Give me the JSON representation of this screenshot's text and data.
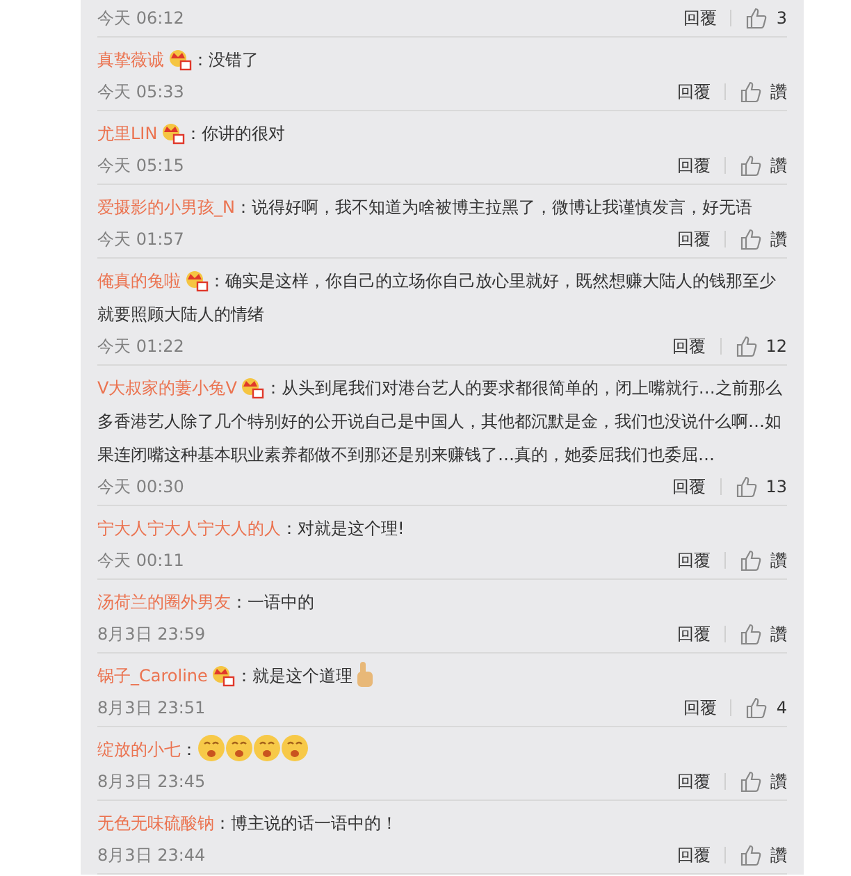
{
  "comments": [
    {
      "partial": true,
      "time": "今天 06:12",
      "reply": "回覆",
      "likes": "3"
    },
    {
      "name": "真挚薇诚",
      "badge": true,
      "text": "：没错了",
      "time": "今天 05:33",
      "reply": "回覆",
      "likes": "讚"
    },
    {
      "name": "尤里LIN",
      "badge": true,
      "text": "：你讲的很对",
      "time": "今天 05:15",
      "reply": "回覆",
      "likes": "讚"
    },
    {
      "name": "爱摄影的小男孩_N",
      "badge": false,
      "text": "：说得好啊，我不知道为啥被博主拉黑了，微博让我谨慎发言，好无语",
      "time": "今天 01:57",
      "reply": "回覆",
      "likes": "讚"
    },
    {
      "name": "俺真的兔啦",
      "badge": true,
      "text": "：确实是这样，你自己的立场你自己放心里就好，既然想赚大陆人的钱那至少就要照顾大陆人的情绪",
      "time": "今天 01:22",
      "reply": "回覆",
      "likes": "12"
    },
    {
      "name": "V大叔家的萋小兔V",
      "badge": true,
      "text": "：从头到尾我们对港台艺人的要求都很简单的，闭上嘴就行…之前那么多香港艺人除了几个特别好的公开说自己是中国人，其他都沉默是金，我们也没说什么啊…如果连闭嘴这种基本职业素养都做不到那还是别来赚钱了…真的，她委屈我们也委屈…",
      "time": "今天 00:30",
      "reply": "回覆",
      "likes": "13"
    },
    {
      "name": "宁大人宁大人宁大人的人",
      "badge": false,
      "text": "：对就是这个理!",
      "time": "今天 00:11",
      "reply": "回覆",
      "likes": "讚"
    },
    {
      "name": "汤荷兰的圈外男友",
      "badge": false,
      "text": "：一语中的",
      "time": "8月3日 23:59",
      "reply": "回覆",
      "likes": "讚"
    },
    {
      "name": "锅子_Caroline",
      "badge": true,
      "text": "：就是这个道理",
      "emojis": [
        {
          "kind": "thumbs-up"
        }
      ],
      "time": "8月3日 23:51",
      "reply": "回覆",
      "likes": "4"
    },
    {
      "name": "绽放的小七",
      "badge": false,
      "text": "：",
      "emojis": [
        {
          "kind": "face"
        },
        {
          "kind": "face"
        },
        {
          "kind": "face"
        },
        {
          "kind": "face"
        }
      ],
      "time": "8月3日 23:45",
      "reply": "回覆",
      "likes": "讚"
    },
    {
      "name": "无色无味硫酸钠",
      "badge": false,
      "text": "：博主说的话一语中的！",
      "time": "8月3日 23:44",
      "reply": "回覆",
      "likes": "讚"
    }
  ]
}
